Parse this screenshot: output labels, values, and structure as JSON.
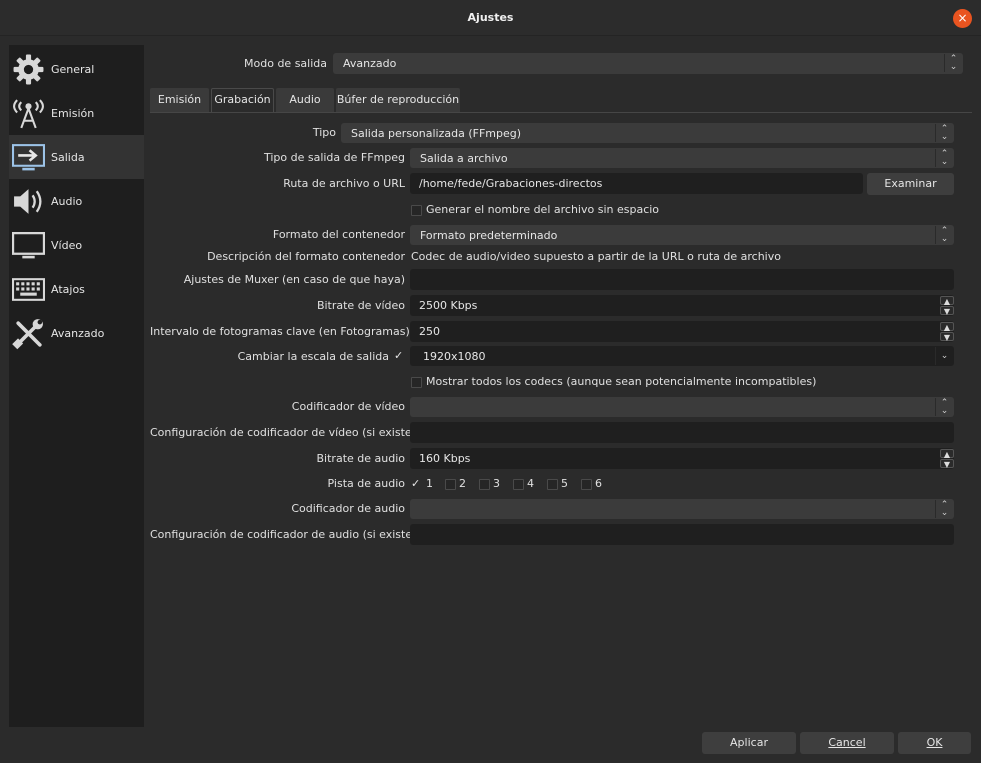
{
  "window": {
    "title": "Ajustes",
    "close_icon": "×"
  },
  "sidebar": {
    "items": [
      {
        "label": "General",
        "icon": "gear-icon"
      },
      {
        "label": "Emisión",
        "icon": "broadcast-icon"
      },
      {
        "label": "Salida",
        "icon": "output-icon",
        "active": true
      },
      {
        "label": "Audio",
        "icon": "speaker-icon"
      },
      {
        "label": "Vídeo",
        "icon": "monitor-icon"
      },
      {
        "label": "Atajos",
        "icon": "keyboard-icon"
      },
      {
        "label": "Avanzado",
        "icon": "tools-icon"
      }
    ]
  },
  "output_mode": {
    "label": "Modo de salida",
    "value": "Avanzado"
  },
  "tabs": [
    "Emisión",
    "Grabación",
    "Audio",
    "Búfer de reproducción"
  ],
  "active_tab": "Grabación",
  "form": {
    "type": {
      "label": "Tipo",
      "value": "Salida personalizada (FFmpeg)"
    },
    "ffmpeg_output_type": {
      "label": "Tipo de salida de FFmpeg",
      "value": "Salida a archivo"
    },
    "path": {
      "label": "Ruta de archivo o URL",
      "value": "/home/fede/Grabaciones-directos",
      "browse": "Examinar"
    },
    "no_space": {
      "label": "Generar el nombre del archivo sin espacio",
      "checked": false
    },
    "container_format": {
      "label": "Formato del contenedor",
      "value": "Formato predeterminado"
    },
    "container_desc": {
      "label": "Descripción del formato contenedor",
      "value": "Codec de audio/video supuesto a partir de la URL o ruta de archivo"
    },
    "muxer_settings": {
      "label": "Ajustes de Muxer (en caso de que haya)",
      "value": ""
    },
    "video_bitrate": {
      "label": "Bitrate de vídeo",
      "value": "2500 Kbps"
    },
    "keyframe_interval": {
      "label": "Intervalo de fotogramas clave (en Fotogramas)",
      "value": "250"
    },
    "rescale": {
      "label": "Cambiar la escala de salida",
      "checked": true,
      "value": "1920x1080"
    },
    "show_all_codecs": {
      "label": "Mostrar todos los codecs (aunque sean potencialmente incompatibles)",
      "checked": false
    },
    "video_encoder": {
      "label": "Codificador de vídeo",
      "value": ""
    },
    "video_encoder_settings": {
      "label": "Configuración de codificador de vídeo (si existe)",
      "value": ""
    },
    "audio_bitrate": {
      "label": "Bitrate de audio",
      "value": "160 Kbps"
    },
    "audio_track": {
      "label": "Pista de audio",
      "tracks": [
        "1",
        "2",
        "3",
        "4",
        "5",
        "6"
      ],
      "checked": [
        "1"
      ]
    },
    "audio_encoder": {
      "label": "Codificador de audio",
      "value": ""
    },
    "audio_encoder_settings": {
      "label": "Configuración de codificador de audio (si existe)",
      "value": ""
    }
  },
  "footer": {
    "apply": "Aplicar",
    "cancel": "Cancel",
    "ok": "OK"
  },
  "colors": {
    "accent_close": "#e95420",
    "sidebar_bg": "#1e1e1e",
    "window_bg": "#2b2b2b",
    "input_bg": "#1f1f1f",
    "combo_bg": "#3b3b3b"
  }
}
